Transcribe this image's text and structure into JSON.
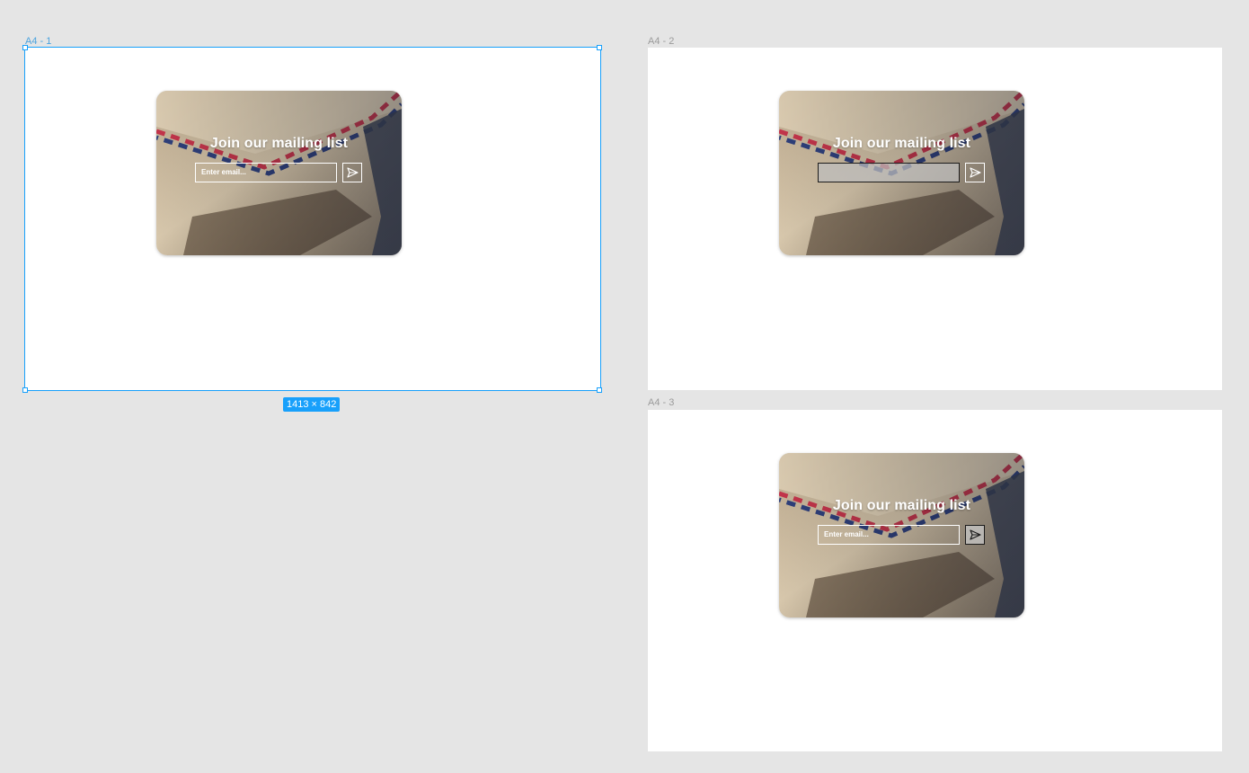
{
  "frames": [
    {
      "label": "A4 - 1",
      "selected": true
    },
    {
      "label": "A4 - 2",
      "selected": false
    },
    {
      "label": "A4 - 3",
      "selected": false
    }
  ],
  "selection_size": "1413 × 842",
  "card": {
    "title": "Join our mailing list",
    "email_placeholder": "Enter email..."
  },
  "icons": {
    "send": "send-icon"
  },
  "colors": {
    "canvas_bg": "#e5e5e5",
    "selection": "#18a0fb",
    "frame_bg": "#ffffff"
  }
}
